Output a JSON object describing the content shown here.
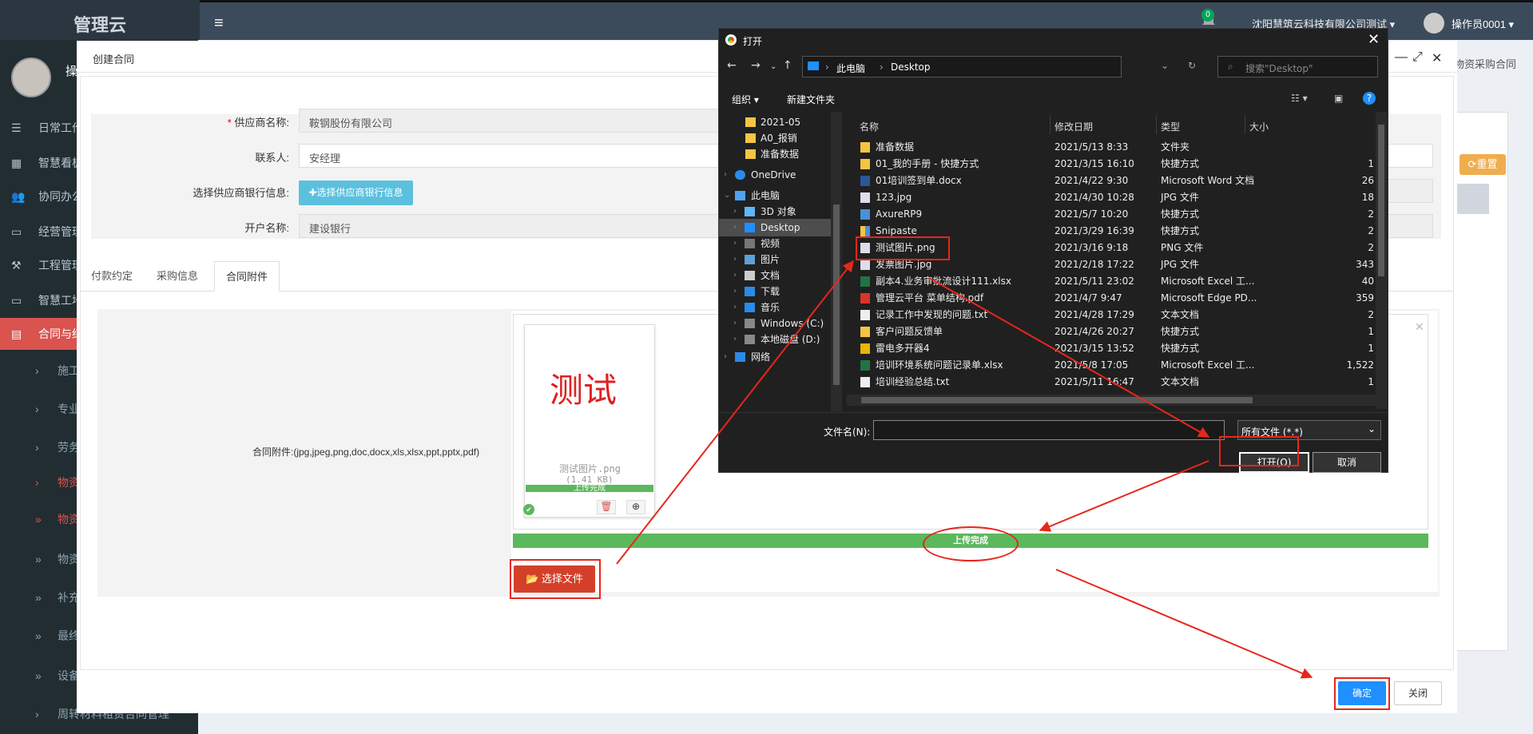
{
  "app": {
    "logo": "管理云",
    "company": "沈阳慧筑云科技有限公司测试 ▾",
    "user": "操作员0001 ▾",
    "notif_count": "0",
    "sidebar_user": "操",
    "right_tab": "物资采购合同",
    "reset_label": "⟳重置"
  },
  "sidebar": {
    "items": [
      {
        "label": "日常工作"
      },
      {
        "label": "智慧看板"
      },
      {
        "label": "协同办公"
      },
      {
        "label": "经营管理"
      },
      {
        "label": "工程管理"
      },
      {
        "label": "智慧工地"
      },
      {
        "label": "合同与结算"
      }
    ],
    "subitems": [
      {
        "label": "施工"
      },
      {
        "label": "专业"
      },
      {
        "label": "劳务"
      },
      {
        "label": "物资"
      },
      {
        "label": "物资"
      },
      {
        "label": "物资"
      },
      {
        "label": "补充"
      },
      {
        "label": "最终"
      },
      {
        "label": "设备"
      },
      {
        "label": "周转材料租赁合同管理"
      }
    ]
  },
  "modal": {
    "title": "创建合同",
    "form": {
      "supplier_label": "供应商名称:",
      "supplier_required": "*",
      "supplier_value": "鞍钢股份有限公司",
      "contact_label": "联系人:",
      "contact_value": "安经理",
      "bank_label": "选择供应商银行信息:",
      "bank_button": "✚选择供应商银行信息",
      "account_label": "开户名称:",
      "account_value": "建设银行"
    },
    "tabs": [
      {
        "label": "付款约定"
      },
      {
        "label": "采购信息"
      },
      {
        "label": "合同附件"
      }
    ],
    "attachment": {
      "label": "合同附件:(jpg,jpeg,png,doc,docx,xls,xlsx,ppt,pptx,pdf)",
      "thumb_text": "测试",
      "file_name": "测试图片.png",
      "file_size": "(1.41 KB)",
      "thumb_status": "上传完成",
      "upload_status": "上传完成",
      "choose_button": "选择文件"
    },
    "ok_button": "确定",
    "close_button": "关闭"
  },
  "file_dialog": {
    "title": "打开",
    "breadcrumb": [
      "此电脑",
      "Desktop"
    ],
    "search_placeholder": "搜索\"Desktop\"",
    "toolbar": {
      "organize": "组织 ▾",
      "new_folder": "新建文件夹"
    },
    "tree": [
      {
        "label": "2021-05",
        "type": "folder"
      },
      {
        "label": "A0_报销",
        "type": "folder"
      },
      {
        "label": "准备数据",
        "type": "folder"
      },
      {
        "label": "OneDrive",
        "type": "cloud"
      },
      {
        "label": "此电脑",
        "type": "pc"
      },
      {
        "label": "3D 对象",
        "type": "3d"
      },
      {
        "label": "Desktop",
        "type": "desktop"
      },
      {
        "label": "视频",
        "type": "video"
      },
      {
        "label": "图片",
        "type": "image"
      },
      {
        "label": "文档",
        "type": "doc"
      },
      {
        "label": "下载",
        "type": "download"
      },
      {
        "label": "音乐",
        "type": "music"
      },
      {
        "label": "Windows (C:)",
        "type": "drive"
      },
      {
        "label": "本地磁盘 (D:)",
        "type": "drive"
      },
      {
        "label": "网络",
        "type": "network"
      }
    ],
    "columns": {
      "name": "名称",
      "date": "修改日期",
      "type": "类型",
      "size": "大小"
    },
    "files": [
      {
        "name": "准备数据",
        "date": "2021/5/13 8:33",
        "type": "文件夹",
        "size": "",
        "icon": "folder"
      },
      {
        "name": "01_我的手册 - 快捷方式",
        "date": "2021/3/15 16:10",
        "type": "快捷方式",
        "size": "1",
        "icon": "folder"
      },
      {
        "name": "01培训签到单.docx",
        "date": "2021/4/22 9:30",
        "type": "Microsoft Word 文档",
        "size": "26",
        "icon": "word"
      },
      {
        "name": "123.jpg",
        "date": "2021/4/30 10:28",
        "type": "JPG 文件",
        "size": "18",
        "icon": "image"
      },
      {
        "name": "AxureRP9",
        "date": "2021/5/7 10:20",
        "type": "快捷方式",
        "size": "2",
        "icon": "axure"
      },
      {
        "name": "Snipaste",
        "date": "2021/3/29 16:39",
        "type": "快捷方式",
        "size": "2",
        "icon": "snipaste"
      },
      {
        "name": "测试图片.png",
        "date": "2021/3/16 9:18",
        "type": "PNG 文件",
        "size": "2",
        "icon": "image"
      },
      {
        "name": "发票图片.jpg",
        "date": "2021/2/18 17:22",
        "type": "JPG 文件",
        "size": "343",
        "icon": "image"
      },
      {
        "name": "副本4.业务审批流设计111.xlsx",
        "date": "2021/5/11 23:02",
        "type": "Microsoft Excel 工...",
        "size": "40",
        "icon": "excel"
      },
      {
        "name": "管理云平台 菜单结构.pdf",
        "date": "2021/4/7 9:47",
        "type": "Microsoft Edge PD...",
        "size": "359",
        "icon": "pdf"
      },
      {
        "name": "记录工作中发现的问题.txt",
        "date": "2021/4/28 17:29",
        "type": "文本文档",
        "size": "2",
        "icon": "txt"
      },
      {
        "name": "客户问题反馈单",
        "date": "2021/4/26 20:27",
        "type": "快捷方式",
        "size": "1",
        "icon": "folder"
      },
      {
        "name": "雷电多开器4",
        "date": "2021/3/15 13:52",
        "type": "快捷方式",
        "size": "1",
        "icon": "app"
      },
      {
        "name": "培训环境系统问题记录单.xlsx",
        "date": "2021/5/8 17:05",
        "type": "Microsoft Excel 工...",
        "size": "1,522",
        "icon": "excel"
      },
      {
        "name": "培训经验总结.txt",
        "date": "2021/5/11 16:47",
        "type": "文本文档",
        "size": "1",
        "icon": "txt"
      }
    ],
    "filename_label": "文件名(N):",
    "filename_value": "",
    "filetype": "所有文件 (*.*)",
    "open_button": "打开(O)",
    "cancel_button": "取消"
  },
  "colors": {
    "annotation_red": "#e8261b",
    "upload_green": "#5cb85c",
    "primary_blue": "#1e90ff",
    "sidebar_active": "#d9534f"
  }
}
